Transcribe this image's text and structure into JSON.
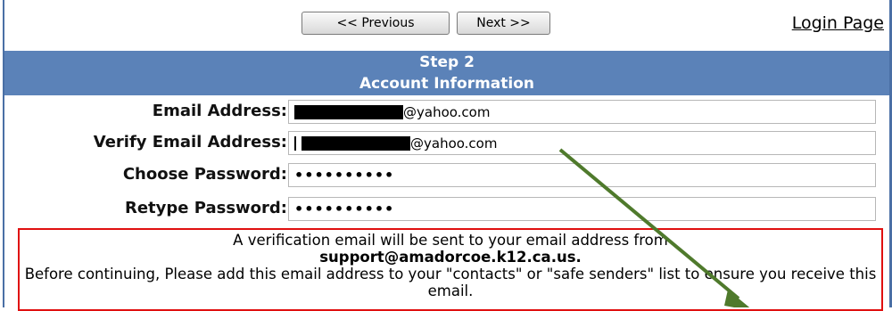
{
  "nav": {
    "previous_label": "<< Previous",
    "next_label": "Next >>",
    "login_label": "Login Page"
  },
  "header": {
    "step": "Step 2",
    "title": "Account Information"
  },
  "form": {
    "email": {
      "label": "Email Address:",
      "value_suffix": "@yahoo.com"
    },
    "verify_email": {
      "label": "Verify Email Address:",
      "value_suffix": "@yahoo.com"
    },
    "password": {
      "label": "Choose Password:",
      "value": "••••••••••"
    },
    "retype_password": {
      "label": "Retype Password:",
      "value": "••••••••••"
    }
  },
  "notice": {
    "line1": "A verification email will be sent to your email address from",
    "email": "support@amadorcoe.k12.ca.us.",
    "line3": "Before continuing, Please add this email address to your \"contacts\" or \"safe senders\" list to ensure you receive this email."
  },
  "colors": {
    "header_bg": "#5b82b8",
    "notice_border": "#e01010",
    "annotation_arrow": "#4f7a2c"
  }
}
